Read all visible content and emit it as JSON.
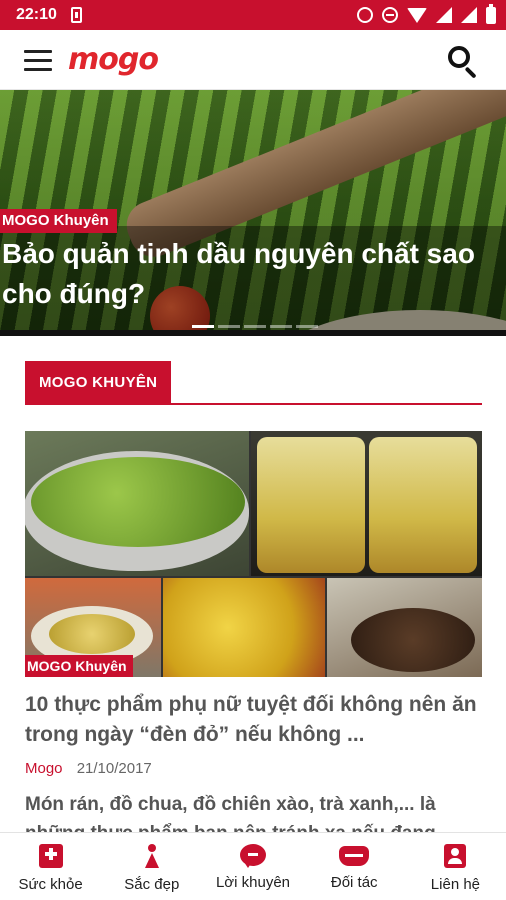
{
  "status_bar": {
    "time": "22:10",
    "icons": [
      "sim-card-icon",
      "alarm-icon",
      "do-not-disturb-icon",
      "wifi-icon",
      "signal-icon",
      "signal-roaming-icon",
      "battery-icon"
    ]
  },
  "app_bar": {
    "logo": "mogo",
    "menu_icon": "hamburger-menu-icon",
    "search_icon": "search-icon"
  },
  "hero": {
    "tag": "MOGO Khuyên",
    "title": "Bảo quản tinh dầu nguyên chất sao cho đúng?",
    "slides_total": 5,
    "active_slide": 1
  },
  "section": {
    "title": "MOGO KHUYÊN"
  },
  "article": {
    "tag": "MOGO Khuyên",
    "title": "10 thực phẩm phụ nữ tuyệt đối không nên ăn trong ngày “đèn đỏ” nếu không ...",
    "author": "Mogo",
    "date": "21/10/2017",
    "summary": "Món rán, đồ chua, đồ chiên xào, trà xanh,... là những thực phẩm bạn nên tránh xa nếu đang"
  },
  "bottom_nav": {
    "items": [
      {
        "label": "Sức khỏe",
        "icon": "health-icon"
      },
      {
        "label": "Sắc đẹp",
        "icon": "beauty-icon"
      },
      {
        "label": "Lời khuyên",
        "icon": "advice-icon"
      },
      {
        "label": "Đối tác",
        "icon": "partner-icon"
      },
      {
        "label": "Liên hệ",
        "icon": "contact-icon"
      }
    ]
  },
  "colors": {
    "brand_red": "#c8102e",
    "text_gray": "#555555"
  }
}
